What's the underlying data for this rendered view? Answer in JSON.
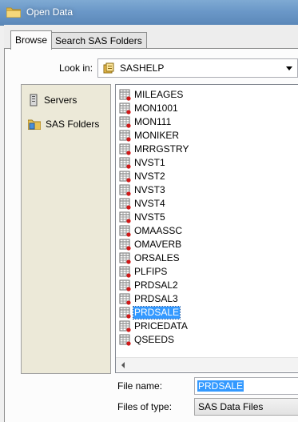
{
  "window": {
    "title": "Open Data"
  },
  "tabs": [
    {
      "label": "Browse",
      "active": true
    },
    {
      "label": "Search SAS Folders",
      "active": false
    }
  ],
  "look_in": {
    "label": "Look in:",
    "value": "SASHELP"
  },
  "places": [
    {
      "label": "Servers",
      "icon": "server-icon"
    },
    {
      "label": "SAS Folders",
      "icon": "sas-folders-icon"
    }
  ],
  "files": [
    "MILEAGES",
    "MON1001",
    "MON111",
    "MONIKER",
    "MRRGSTRY",
    "NVST1",
    "NVST2",
    "NVST3",
    "NVST4",
    "NVST5",
    "OMAASSC",
    "OMAVERB",
    "ORSALES",
    "PLFIPS",
    "PRDSAL2",
    "PRDSAL3",
    "PRDSALE",
    "PRICEDATA",
    "QSEEDS"
  ],
  "selected_file": "PRDSALE",
  "file_name": {
    "label": "File name:",
    "value": "PRDSALE"
  },
  "file_type": {
    "label": "Files of type:",
    "value": "SAS Data Files"
  }
}
